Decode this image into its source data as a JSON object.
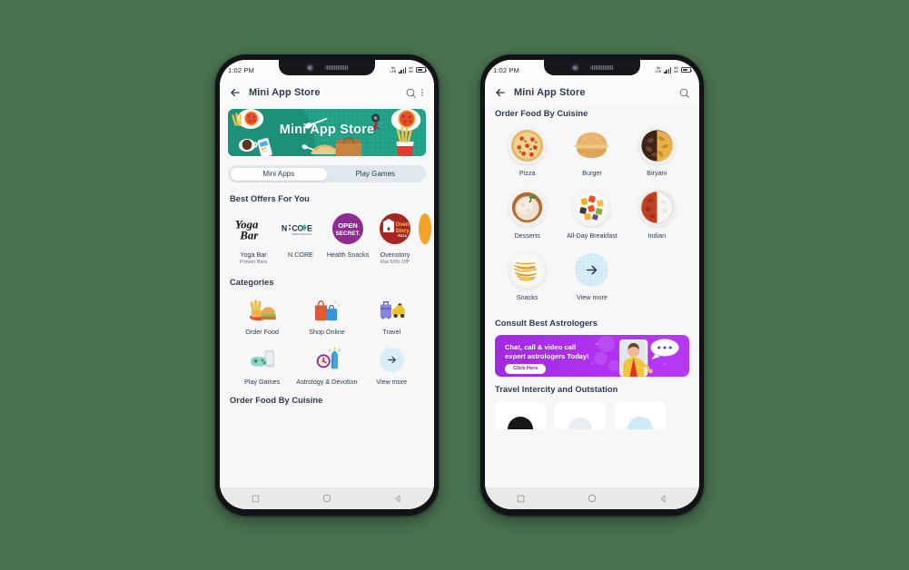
{
  "background_color": "#4a7351",
  "phones": [
    {
      "id": "left",
      "status_bar": {
        "time": "1:02 PM",
        "volte": "VoLTE",
        "network": "4G",
        "network2": "3G"
      },
      "app_bar": {
        "title": "Mini App Store",
        "back_icon": "arrow-left-icon",
        "search_icon": "search-icon",
        "menu_icon": "kebab-menu-icon"
      },
      "hero": {
        "title": "Mini App Store",
        "bg_color": "#23a388"
      },
      "tabs": [
        {
          "label": "Mini Apps",
          "active": true
        },
        {
          "label": "Play Games",
          "active": false
        }
      ],
      "offers": {
        "heading": "Best Offers For You",
        "items": [
          {
            "name": "Yoga Bar",
            "subtitle": "Protein Bars",
            "logo_type": "wordmark",
            "logo_text": "Yoga Bar",
            "color": "#111111"
          },
          {
            "name": "N CORE",
            "subtitle": "",
            "logo_type": "wordmark",
            "logo_text": "N CORE",
            "color": "#18324a"
          },
          {
            "name": "Health Snacks",
            "subtitle": "",
            "logo_type": "circle",
            "logo_text": "OPEN SECRET",
            "color": "#8e2a91"
          },
          {
            "name": "Ovenstory",
            "subtitle": "Flat 50% Off*",
            "logo_type": "circle",
            "logo_text": "Oven Story PIZZA",
            "color": "#a82521"
          }
        ]
      },
      "categories": {
        "heading": "Categories",
        "items": [
          {
            "label": "Order Food",
            "icon": "food-tray-icon"
          },
          {
            "label": "Shop Online",
            "icon": "shopping-bags-icon"
          },
          {
            "label": "Travel",
            "icon": "luggage-taxi-icon"
          },
          {
            "label": "Play Games",
            "icon": "gamepad-icon"
          },
          {
            "label": "Astrology & Devotion",
            "icon": "astrology-icon"
          },
          {
            "label": "View more",
            "icon": "arrow-right-icon"
          }
        ]
      },
      "next_section_heading": "Order Food By Cuisine",
      "nav_bar": {
        "recent": "square-icon",
        "home": "circle-icon",
        "back": "triangle-back-icon"
      }
    },
    {
      "id": "right",
      "status_bar": {
        "time": "1:02 PM",
        "volte": "VoLTE",
        "network": "4G",
        "network2": "3G"
      },
      "app_bar": {
        "title": "Mini App Store",
        "back_icon": "arrow-left-icon",
        "search_icon": "search-icon"
      },
      "cuisine": {
        "heading": "Order Food By Cuisine",
        "items": [
          {
            "label": "Pizza",
            "icon": "pizza-image"
          },
          {
            "label": "Burger",
            "icon": "burger-image"
          },
          {
            "label": "Biryani",
            "icon": "biryani-image"
          },
          {
            "label": "Desserts",
            "icon": "dessert-image"
          },
          {
            "label": "All-Day Breakfast",
            "icon": "breakfast-image"
          },
          {
            "label": "Indian",
            "icon": "indian-food-image"
          },
          {
            "label": "Snacks",
            "icon": "snacks-image"
          },
          {
            "label": "View more",
            "icon": "arrow-right-icon"
          }
        ]
      },
      "astrologers": {
        "heading": "Consult Best Astrologers",
        "banner_line1": "Chat, call & video call",
        "banner_line2": "expert astrologers Today!",
        "button_label": "Click Here",
        "banner_color": "#ad30ee"
      },
      "travel": {
        "heading": "Travel Intercity and Outstation"
      },
      "nav_bar": {
        "recent": "square-icon",
        "home": "circle-icon",
        "back": "triangle-back-icon"
      }
    }
  ]
}
